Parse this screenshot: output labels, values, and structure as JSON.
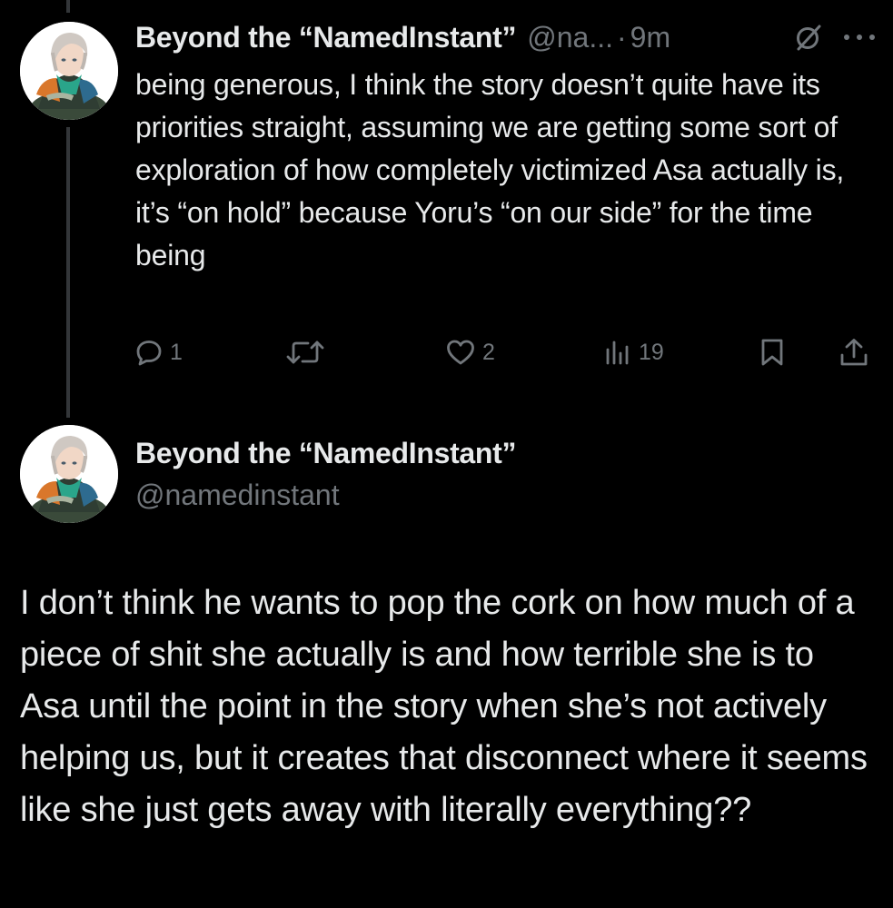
{
  "accent": "#1d9bf0",
  "colors": {
    "background": "#000000",
    "text_primary": "#e7e9ea",
    "text_secondary": "#71767b",
    "thread_line": "#333639"
  },
  "tweet1": {
    "display_name": "Beyond the “NamedInstant”",
    "handle_truncated": "@na...",
    "separator": "·",
    "time": "9m",
    "header_icons": [
      "grok-slash-icon",
      "more-icon"
    ],
    "text": "being generous, I think the story doesn’t quite have its priorities straight, assuming we are getting some sort of exploration of how completely victimized Asa actually is, it’s “on hold” because Yoru’s “on our side” for the time being",
    "actions": {
      "replies": "1",
      "reposts": "",
      "likes": "2",
      "views": "19"
    }
  },
  "tweet2": {
    "display_name": "Beyond the “NamedInstant”",
    "handle": "@namedinstant",
    "text": "I don’t think he wants to pop the cork on how much of a piece of shit she actually is and how terrible she is to Asa until the point in the story when she’s not actively helping us, but it creates that disconnect where it seems like she just gets away with literally everything??"
  }
}
